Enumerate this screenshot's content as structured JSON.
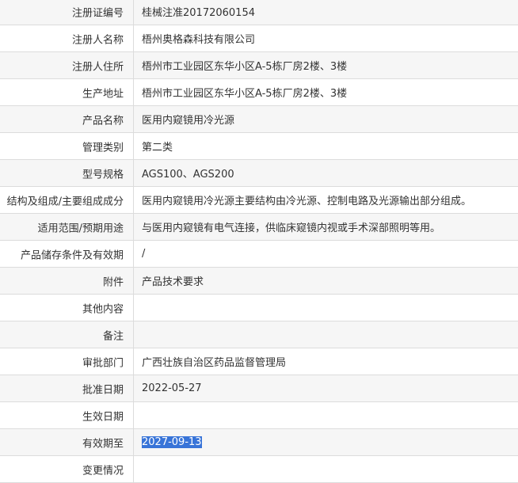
{
  "rows": [
    {
      "label": "注册证编号",
      "value": "桂械注准20172060154"
    },
    {
      "label": "注册人名称",
      "value": "梧州奥格森科技有限公司"
    },
    {
      "label": "注册人住所",
      "value": "梧州市工业园区东华小区A-5栋厂房2楼、3楼"
    },
    {
      "label": "生产地址",
      "value": "梧州市工业园区东华小区A-5栋厂房2楼、3楼"
    },
    {
      "label": "产品名称",
      "value": "医用内窥镜用冷光源"
    },
    {
      "label": "管理类别",
      "value": "第二类"
    },
    {
      "label": "型号规格",
      "value": "AGS100、AGS200"
    },
    {
      "label": "结构及组成/主要组成成分",
      "value": "医用内窥镜用冷光源主要结构由冷光源、控制电路及光源输出部分组成。"
    },
    {
      "label": "适用范围/预期用途",
      "value": "与医用内窥镜有电气连接，供临床窥镜内视或手术深部照明等用。"
    },
    {
      "label": "产品储存条件及有效期",
      "value": "/"
    },
    {
      "label": "附件",
      "value": "产品技术要求"
    },
    {
      "label": "其他内容",
      "value": ""
    },
    {
      "label": "备注",
      "value": ""
    },
    {
      "label": "审批部门",
      "value": "广西壮族自治区药品监督管理局"
    },
    {
      "label": "批准日期",
      "value": "2022-05-27"
    },
    {
      "label": "生效日期",
      "value": ""
    },
    {
      "label": "有效期至",
      "value": "2027-09-13"
    },
    {
      "label": "变更情况",
      "value": ""
    }
  ]
}
